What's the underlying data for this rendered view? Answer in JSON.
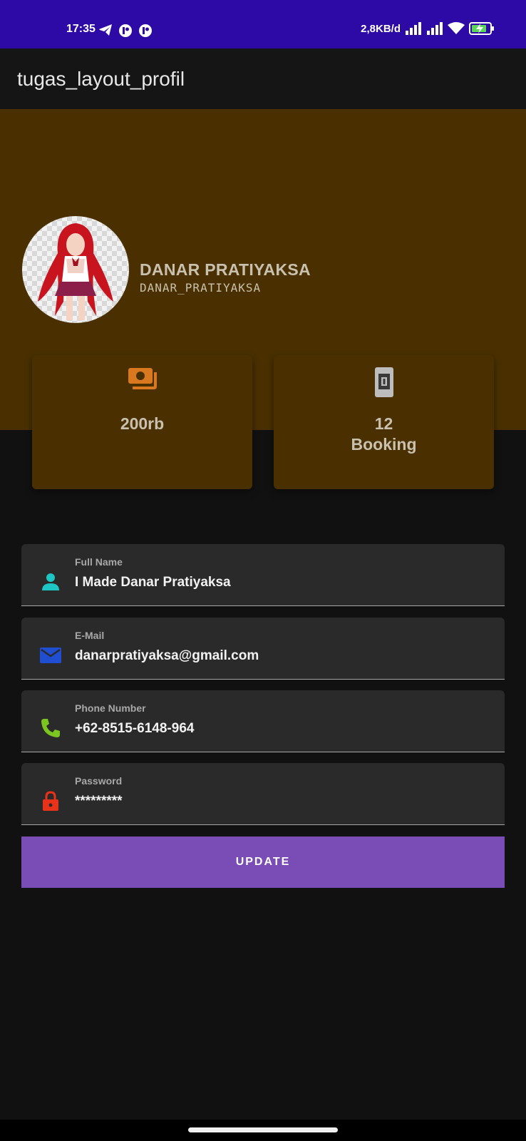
{
  "status_bar": {
    "time": "17:35",
    "net_speed": "2,8KB/d",
    "icons": [
      "telegram-icon",
      "app-notification-icon",
      "app-notification-icon",
      "signal-icon",
      "signal-icon",
      "wifi-icon",
      "battery-charging-icon"
    ]
  },
  "app_bar": {
    "title": "tugas_layout_profil"
  },
  "profile": {
    "name": "DANAR PRATIYAKSA",
    "username": "DANAR_PRATIYAKSA",
    "avatar_icon": "profile-avatar-image"
  },
  "stats": [
    {
      "icon": "money-icon",
      "value": "200rb"
    },
    {
      "icon": "booking-icon",
      "value": "12\nBooking"
    }
  ],
  "fields": [
    {
      "icon": "person-icon",
      "label": "Full Name",
      "value": "I Made Danar Pratiyaksa"
    },
    {
      "icon": "email-icon",
      "label": "E-Mail",
      "value": "danarpratiyaksa@gmail.com"
    },
    {
      "icon": "phone-icon",
      "label": "Phone Number",
      "value": "+62-8515-6148-964"
    },
    {
      "icon": "lock-icon",
      "label": "Password",
      "value": "*********"
    }
  ],
  "update_button": {
    "label": "UPDATE"
  },
  "colors": {
    "status_bar": "#2d0aa5",
    "header": "#4a3000",
    "accent_button": "#7a4cb6",
    "person_icon": "#1ec5c5",
    "email_icon": "#1f4fd0",
    "phone_icon": "#7cc520",
    "lock_icon": "#e8321a",
    "money_icon": "#d9781e"
  }
}
